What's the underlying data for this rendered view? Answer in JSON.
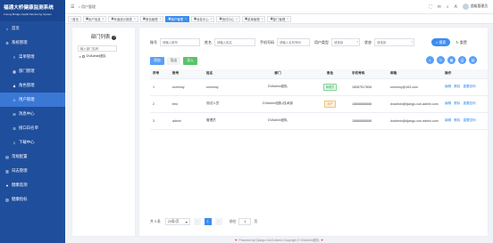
{
  "app": {
    "title": "福通大桥健康监测系统",
    "subtitle": "Futong Bridge Health Monitoring System"
  },
  "sidebar": {
    "items": [
      {
        "label": "首页",
        "icon": "home-icon",
        "glyph": "⌂"
      },
      {
        "label": "系统管理",
        "icon": "gear-icon",
        "glyph": "⚙",
        "expanded": true
      },
      {
        "label": "菜单管理",
        "icon": "menu-icon",
        "glyph": "≡",
        "sub": true
      },
      {
        "label": "部门管理",
        "icon": "org-icon",
        "glyph": "▦",
        "sub": true
      },
      {
        "label": "角色管理",
        "icon": "role-icon",
        "glyph": "♟",
        "sub": true
      },
      {
        "label": "用户管理",
        "icon": "user-icon",
        "glyph": "☺",
        "sub": true,
        "active": true
      },
      {
        "label": "消息中心",
        "icon": "message-icon",
        "glyph": "✉",
        "sub": true
      },
      {
        "label": "接口白名单",
        "icon": "whitelist-icon",
        "glyph": "☰",
        "sub": true
      },
      {
        "label": "下载中心",
        "icon": "download-icon",
        "glyph": "⇩",
        "sub": true
      },
      {
        "label": "常规配置",
        "icon": "config-icon",
        "glyph": "▤"
      },
      {
        "label": "日志管理",
        "icon": "log-icon",
        "glyph": "▥"
      },
      {
        "label": "健康监测",
        "icon": "health-icon",
        "glyph": "♥"
      },
      {
        "label": "健康指标",
        "icon": "chart-icon",
        "glyph": "▨"
      }
    ]
  },
  "topbar": {
    "toggle_icon": "☰",
    "breadcrumb": "⌂ 用户管理",
    "actions": [
      {
        "name": "fullscreen-icon",
        "glyph": "⛶"
      },
      {
        "name": "notification-icon",
        "glyph": "✉"
      },
      {
        "name": "search-icon",
        "glyph": "⌕"
      },
      {
        "name": "language-icon",
        "glyph": "A"
      }
    ],
    "username": "超级管理员"
  },
  "tabs": [
    {
      "label": "首页",
      "closable": false
    },
    {
      "label": "用户信息",
      "closable": true
    },
    {
      "label": "年度统计报表",
      "closable": true
    },
    {
      "label": "角色管理",
      "closable": true
    },
    {
      "label": "用户管理",
      "closable": true,
      "active": true
    },
    {
      "label": "消息中心",
      "closable": true
    },
    {
      "label": "测试中心",
      "closable": true
    },
    {
      "label": "菜单管理",
      "closable": true
    },
    {
      "label": "部门管理",
      "closable": true
    }
  ],
  "dept_panel": {
    "title": "部门列表",
    "help_icon": "?",
    "search_placeholder": "输入部门名称",
    "tree_root": "DVAdmin团队"
  },
  "filters": {
    "account_label": "账号",
    "account_placeholder": "请输入账号",
    "name_label": "姓名",
    "name_placeholder": "请输入姓名",
    "mobile_label": "手机号码",
    "mobile_placeholder": "请输入手机号码",
    "usertype_label": "用户类型",
    "usertype_placeholder": "请选择",
    "status_label": "状态",
    "status_placeholder": "请选择",
    "search_button": "搜索",
    "reset_button": "重置"
  },
  "actions": {
    "add": "添加",
    "export": "导出",
    "import": "导入"
  },
  "tool_icons": [
    "⌕",
    "↻",
    "▦",
    "⎙",
    "▤"
  ],
  "table": {
    "columns": [
      "序号",
      "账号",
      "姓名",
      "部门",
      "角色",
      "手机号码",
      "邮箱",
      "操作"
    ],
    "rows": [
      {
        "index": "1",
        "account": "sommny",
        "name": "sommny",
        "dept": "DVAdmin团队",
        "role": "管理员",
        "role_color": "green",
        "mobile": "18087517808",
        "email": "sommny@163.com",
        "ops": [
          "编辑",
          "删除",
          "重置密码"
        ]
      },
      {
        "index": "2",
        "account": "test",
        "name": "测试人员",
        "dept": "DVAdmin团队/技术部",
        "role": "用户",
        "role_color": "orange",
        "mobile": "18888888888",
        "email": "dvadmin@django-vue-admin.com",
        "ops": [
          "编辑",
          "删除",
          "重置密码"
        ]
      },
      {
        "index": "3",
        "account": "admin",
        "name": "管理员",
        "dept": "DVAdmin团队",
        "role": "",
        "role_color": "",
        "mobile": "18888888888",
        "email": "dvadmin@django-vue-admin.com",
        "ops": [
          "编辑",
          "删除",
          "重置密码"
        ]
      }
    ]
  },
  "pagination": {
    "total": "共 3 条",
    "page_size": "20条/页",
    "prev": "‹",
    "current": "1",
    "next": "›",
    "goto_label": "前往",
    "goto_value": "1",
    "page_suffix": "页"
  },
  "footer": {
    "text": "Powered by Django-Vue3-Admin Copyright © DVAdmin团队"
  }
}
